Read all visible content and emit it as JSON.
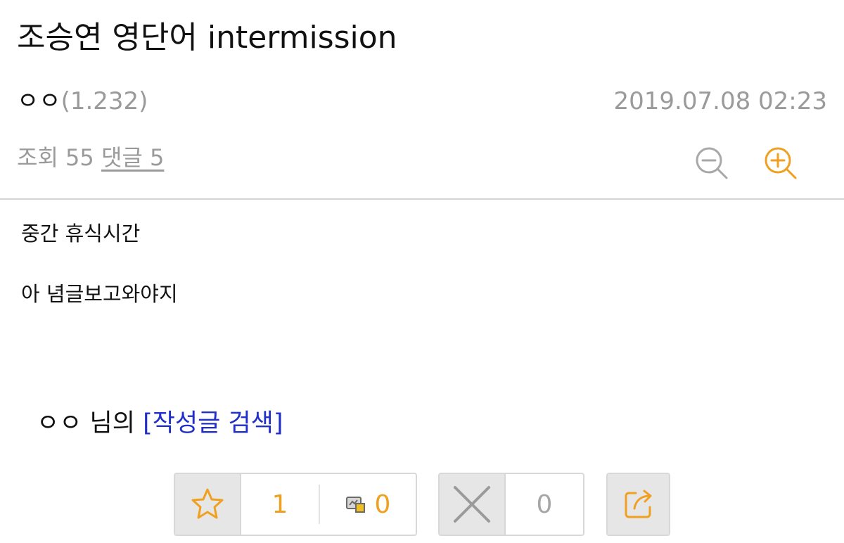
{
  "post": {
    "title": "조승연 영단어 intermission",
    "author": "ㅇㅇ",
    "ip": "(1.232)",
    "datetime": "2019.07.08 02:23",
    "views_text": "조회 55",
    "comments_text": "댓글 5",
    "body_lines": [
      "중간 휴식시간",
      "아 념글보고와야지"
    ]
  },
  "search": {
    "author": "ㅇㅇ",
    "suffix": " 님의 ",
    "link_label": "[작성글 검색]"
  },
  "votes": {
    "up": "1",
    "fixed_up": "0",
    "down": "0"
  },
  "icons": {
    "zoom_out": "zoom-out-icon",
    "zoom_in": "zoom-in-icon",
    "star": "star-icon",
    "fixed": "fixed-recommend-icon",
    "down": "x-icon",
    "share": "share-icon"
  },
  "colors": {
    "accent": "#f0a020",
    "link": "#1f2fc8",
    "muted": "#9a9a9a"
  }
}
